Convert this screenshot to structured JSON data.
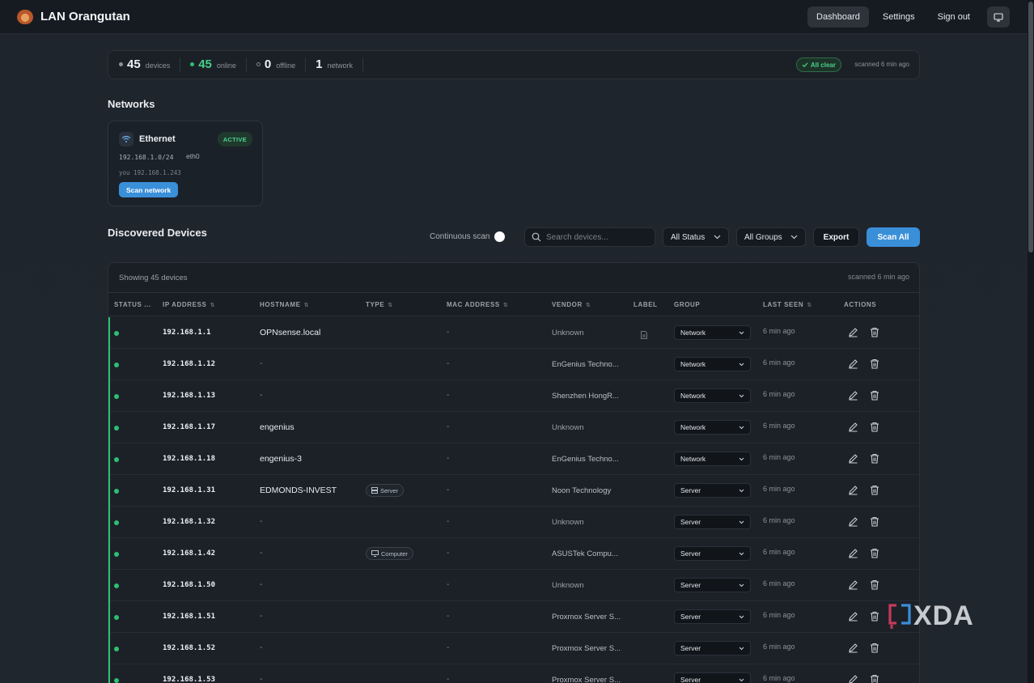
{
  "app": {
    "title": "LAN Orangutan"
  },
  "nav": {
    "dashboard": "Dashboard",
    "settings": "Settings",
    "signout": "Sign out"
  },
  "summary": {
    "devices_count": "45",
    "devices_label": "devices",
    "online_count": "45",
    "online_label": "online",
    "offline_count": "0",
    "offline_label": "offline",
    "network_count": "1",
    "network_label": "network",
    "status_badge": "All clear",
    "scanned": "scanned 6 min ago"
  },
  "networks": {
    "title": "Networks",
    "card": {
      "name": "Ethernet",
      "badge": "ACTIVE",
      "cidr": "192.168.1.0/24",
      "iface": "eth0",
      "you": "you 192.168.1.243",
      "scan_button": "Scan network"
    }
  },
  "devices": {
    "title": "Discovered Devices",
    "continuous_scan_label": "Continuous scan",
    "search_placeholder": "Search devices...",
    "status_filter": "All Status",
    "group_filter": "All Groups",
    "export_label": "Export",
    "scan_all_label": "Scan All",
    "showing": "Showing 45 devices",
    "scanned": "scanned 6 min ago",
    "columns": [
      "STATUS ...",
      "IP ADDRESS",
      "HOSTNAME",
      "TYPE",
      "MAC ADDRESS",
      "VENDOR",
      "LABEL",
      "GROUP",
      "LAST SEEN",
      "ACTIONS"
    ],
    "rows": [
      {
        "ip": "192.168.1.1",
        "hostname": "OPNsense.local",
        "type": "",
        "mac": "-",
        "vendor": "Unknown",
        "group": "Network",
        "last_seen": "6 min ago",
        "has_label": true
      },
      {
        "ip": "192.168.1.12",
        "hostname": "-",
        "type": "",
        "mac": "-",
        "vendor": "EnGenius Techno...",
        "group": "Network",
        "last_seen": "6 min ago"
      },
      {
        "ip": "192.168.1.13",
        "hostname": "-",
        "type": "",
        "mac": "-",
        "vendor": "Shenzhen HongR...",
        "group": "Network",
        "last_seen": "6 min ago"
      },
      {
        "ip": "192.168.1.17",
        "hostname": "engenius",
        "type": "",
        "mac": "-",
        "vendor": "Unknown",
        "group": "Network",
        "last_seen": "6 min ago"
      },
      {
        "ip": "192.168.1.18",
        "hostname": "engenius-3",
        "type": "",
        "mac": "-",
        "vendor": "EnGenius Techno...",
        "group": "Network",
        "last_seen": "6 min ago"
      },
      {
        "ip": "192.168.1.31",
        "hostname": "EDMONDS-INVEST",
        "type": "Server",
        "mac": "-",
        "vendor": "Noon Technology",
        "group": "Server",
        "last_seen": "6 min ago"
      },
      {
        "ip": "192.168.1.32",
        "hostname": "-",
        "type": "",
        "mac": "-",
        "vendor": "Unknown",
        "group": "Server",
        "last_seen": "6 min ago"
      },
      {
        "ip": "192.168.1.42",
        "hostname": "-",
        "type": "Computer",
        "mac": "-",
        "vendor": "ASUSTek Compu...",
        "group": "Server",
        "last_seen": "6 min ago"
      },
      {
        "ip": "192.168.1.50",
        "hostname": "-",
        "type": "",
        "mac": "-",
        "vendor": "Unknown",
        "group": "Server",
        "last_seen": "6 min ago"
      },
      {
        "ip": "192.168.1.51",
        "hostname": "-",
        "type": "",
        "mac": "-",
        "vendor": "Proxmox Server S...",
        "group": "Server",
        "last_seen": "6 min ago"
      },
      {
        "ip": "192.168.1.52",
        "hostname": "-",
        "type": "",
        "mac": "-",
        "vendor": "Proxmox Server S...",
        "group": "Server",
        "last_seen": "6 min ago"
      },
      {
        "ip": "192.168.1.53",
        "hostname": "-",
        "type": "",
        "mac": "-",
        "vendor": "Proxmox Server S...",
        "group": "Server",
        "last_seen": "6 min ago"
      }
    ]
  },
  "watermark": {
    "text": "XDA"
  },
  "colors": {
    "accent": "#3a8fd9",
    "online": "#2fbf71",
    "background": "#1f252d"
  }
}
